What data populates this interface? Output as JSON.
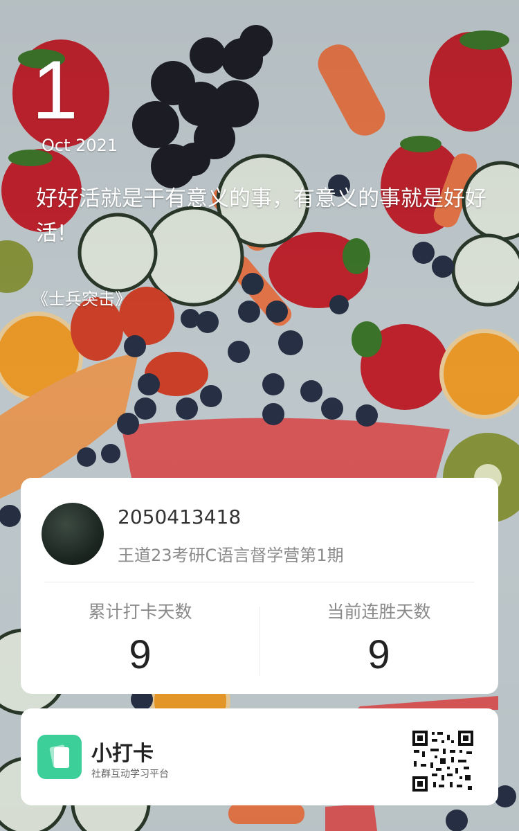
{
  "header": {
    "day": "1",
    "month_year": "Oct 2021",
    "quote": "好好活就是干有意义的事，有意义的事就是好好活!",
    "source": "《士兵突击》"
  },
  "profile": {
    "user_id": "2050413418",
    "group_name": "王道23考研C语言督学营第1期"
  },
  "stats": {
    "total_label": "累计打卡天数",
    "total_value": "9",
    "streak_label": "当前连胜天数",
    "streak_value": "9"
  },
  "footer": {
    "app_name": "小打卡",
    "app_tagline": "社群互动学习平台"
  },
  "colors": {
    "brand_green": "#3ccf9a",
    "card_bg": "#ffffff"
  }
}
